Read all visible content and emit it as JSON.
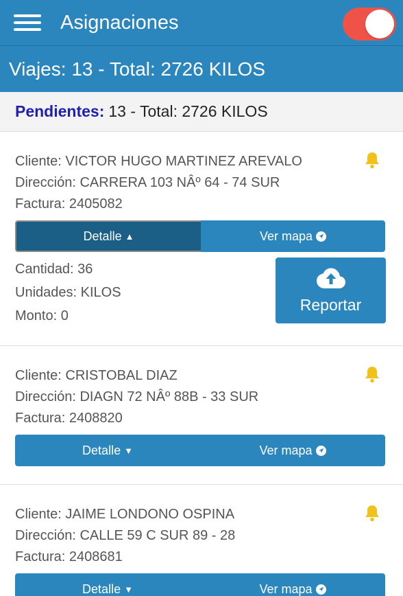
{
  "header": {
    "title": "Asignaciones",
    "toggle_on": true
  },
  "summary": {
    "text": "Viajes: 13 - Total: 2726 KILOS"
  },
  "pending": {
    "label": "Pendientes:",
    "text": "13 - Total: 2726 KILOS"
  },
  "cards": [
    {
      "cliente": "Cliente: VICTOR HUGO MARTINEZ AREVALO",
      "direccion": "Dirección: CARRERA 103 NÂº 64 - 74 SUR",
      "factura": "Factura: 2405082",
      "detalle_label": "Detalle",
      "mapa_label": "Ver mapa",
      "cantidad": "Cantidad: 36",
      "unidades": "Unidades: KILOS",
      "monto": "Monto: 0",
      "reportar_label": "Reportar"
    },
    {
      "cliente": "Cliente: CRISTOBAL DIAZ",
      "direccion": "Dirección: DIAGN 72 NÂº 88B - 33 SUR",
      "factura": "Factura: 2408820",
      "detalle_label": "Detalle",
      "mapa_label": "Ver mapa"
    },
    {
      "cliente": "Cliente: JAIME LONDONO OSPINA",
      "direccion": "Dirección: CALLE 59 C SUR 89 - 28",
      "factura": "Factura: 2408681",
      "detalle_label": "Detalle",
      "mapa_label": "Ver mapa"
    }
  ],
  "colors": {
    "primary": "#2a86bd",
    "primary_dark": "#1b5f87",
    "toggle": "#ef5247",
    "bell": "#f1c21b",
    "pending_label": "#1f1fb0"
  },
  "icons": {
    "menu": "hamburger-icon",
    "bell": "bell-icon",
    "map": "navigation-arrow-icon",
    "upload": "cloud-upload-icon"
  }
}
